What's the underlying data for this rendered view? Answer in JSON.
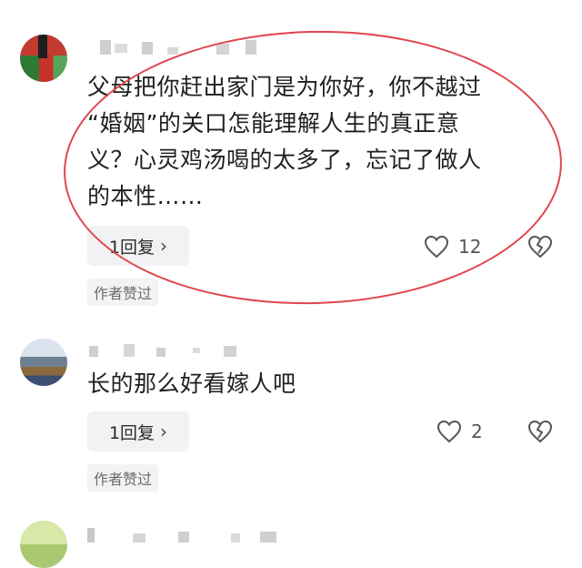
{
  "comments": [
    {
      "text_lines": [
        "父母把你赶出家门是为你好，你不越过",
        "“婚姻”的关口怎能理解人生的真正意",
        "义？心灵鸡汤喝的太多了，忘记了做人",
        "的本性……"
      ],
      "reply_label": "1回复",
      "like_count": "12",
      "author_liked": "作者赞过"
    },
    {
      "text_lines": [
        "长的那么好看嫁人吧"
      ],
      "reply_label": "1回复",
      "like_count": "2",
      "author_liked": "作者赞过"
    }
  ],
  "icons": {
    "reply_chevron": "chevron-right-icon",
    "like": "heart-outline-icon",
    "dislike": "broken-heart-icon"
  },
  "colors": {
    "annotation_circle": "#e0454d",
    "reply_button_bg": "#f1f2f4"
  }
}
